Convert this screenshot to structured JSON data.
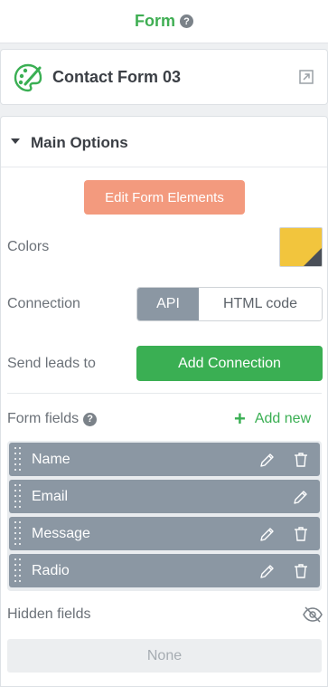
{
  "header": {
    "title": "Form",
    "help": "?"
  },
  "form_card": {
    "name": "Contact Form 03"
  },
  "main_options": {
    "title": "Main Options",
    "edit_button": "Edit Form Elements",
    "colors_label": "Colors",
    "swatch_colors": {
      "primary": "#f2c53d",
      "secondary": "#4a4f58"
    },
    "connection_label": "Connection",
    "connection_options": [
      "API",
      "HTML code"
    ],
    "connection_selected": "API",
    "send_leads_label": "Send leads to",
    "add_connection_button": "Add Connection"
  },
  "form_fields": {
    "label": "Form fields",
    "help": "?",
    "add_new": "Add new",
    "items": [
      {
        "label": "Name",
        "editable": true,
        "deletable": true
      },
      {
        "label": "Email",
        "editable": true,
        "deletable": false
      },
      {
        "label": "Message",
        "editable": true,
        "deletable": true
      },
      {
        "label": "Radio",
        "editable": true,
        "deletable": true
      }
    ]
  },
  "hidden_fields": {
    "label": "Hidden fields",
    "value": "None"
  },
  "colors": {
    "accent_green": "#3aaf53",
    "edit_button": "#f39a7e",
    "field_bg": "#8b97a3"
  }
}
